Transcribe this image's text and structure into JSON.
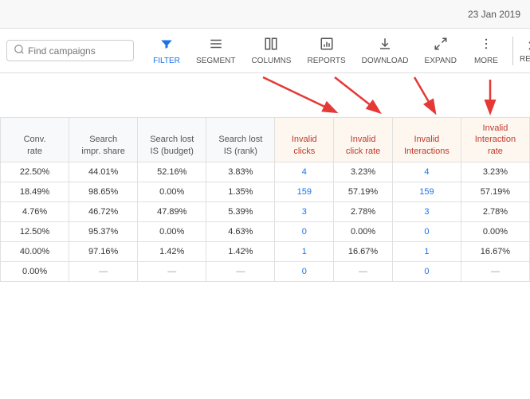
{
  "topbar": {
    "date": "23 Jan 2019"
  },
  "toolbar": {
    "search_placeholder": "Find campaigns",
    "filter_label": "FILTER",
    "segment_label": "SEGMENT",
    "columns_label": "COLUMNS",
    "reports_label": "REPORTS",
    "download_label": "DOWNLOAD",
    "expand_label": "EXPAND",
    "more_label": "MORE",
    "reset_label": "RESET"
  },
  "arrows": {
    "labels": [
      "Invalid clicks",
      "Invalid click rate",
      "Invalid Interactions",
      "Invalid Interaction rate"
    ]
  },
  "table": {
    "columns": [
      {
        "id": "conv_rate",
        "label": "Conv. rate"
      },
      {
        "id": "search_impr",
        "label": "Search impr. share"
      },
      {
        "id": "search_lost_budget",
        "label": "Search lost IS (budget)"
      },
      {
        "id": "search_lost_rank",
        "label": "Search lost IS (rank)"
      },
      {
        "id": "invalid_clicks",
        "label": "Invalid clicks"
      },
      {
        "id": "invalid_click_rate",
        "label": "Invalid click rate"
      },
      {
        "id": "invalid_interactions",
        "label": "Invalid Interactions"
      },
      {
        "id": "invalid_interaction_rate",
        "label": "Invalid Interaction rate"
      }
    ],
    "rows": [
      {
        "conv_rate": "22.50%",
        "search_impr": "44.01%",
        "search_lost_budget": "52.16%",
        "search_lost_rank": "3.83%",
        "invalid_clicks": "4",
        "invalid_click_rate": "3.23%",
        "invalid_interactions": "4",
        "invalid_interaction_rate": "3.23%"
      },
      {
        "conv_rate": "18.49%",
        "search_impr": "98.65%",
        "search_lost_budget": "0.00%",
        "search_lost_rank": "1.35%",
        "invalid_clicks": "159",
        "invalid_click_rate": "57.19%",
        "invalid_interactions": "159",
        "invalid_interaction_rate": "57.19%"
      },
      {
        "conv_rate": "4.76%",
        "search_impr": "46.72%",
        "search_lost_budget": "47.89%",
        "search_lost_rank": "5.39%",
        "invalid_clicks": "3",
        "invalid_click_rate": "2.78%",
        "invalid_interactions": "3",
        "invalid_interaction_rate": "2.78%"
      },
      {
        "conv_rate": "12.50%",
        "search_impr": "95.37%",
        "search_lost_budget": "0.00%",
        "search_lost_rank": "4.63%",
        "invalid_clicks": "0",
        "invalid_click_rate": "0.00%",
        "invalid_interactions": "0",
        "invalid_interaction_rate": "0.00%"
      },
      {
        "conv_rate": "40.00%",
        "search_impr": "97.16%",
        "search_lost_budget": "1.42%",
        "search_lost_rank": "1.42%",
        "invalid_clicks": "1",
        "invalid_click_rate": "16.67%",
        "invalid_interactions": "1",
        "invalid_interaction_rate": "16.67%"
      },
      {
        "conv_rate": "0.00%",
        "search_impr": "—",
        "search_lost_budget": "—",
        "search_lost_rank": "—",
        "invalid_clicks": "0",
        "invalid_click_rate": "—",
        "invalid_interactions": "0",
        "invalid_interaction_rate": "—"
      }
    ]
  }
}
